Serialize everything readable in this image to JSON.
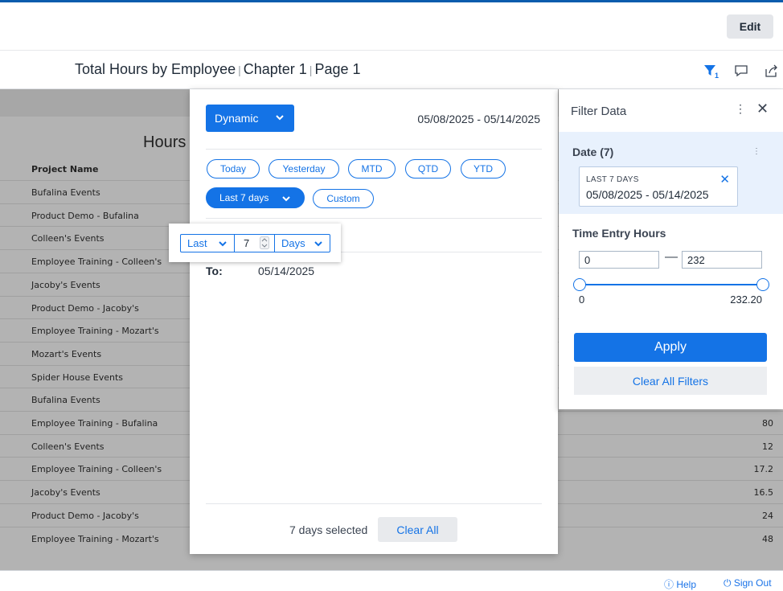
{
  "toolbar": {
    "edit_label": "Edit"
  },
  "report": {
    "title": "Total Hours by Employee",
    "chapter": "Chapter 1",
    "page": "Page 1",
    "filter_count": "1"
  },
  "underlay": {
    "heading": "Hours",
    "column_header": "Project Name",
    "rows": [
      {
        "name": "Bufalina Events",
        "value": ""
      },
      {
        "name": "Product Demo - Bufalina",
        "value": ""
      },
      {
        "name": "Colleen's Events",
        "value": ""
      },
      {
        "name": "Employee Training - Colleen's",
        "value": ""
      },
      {
        "name": "Jacoby's Events",
        "value": ""
      },
      {
        "name": "Product Demo - Jacoby's",
        "value": ""
      },
      {
        "name": "Employee Training - Mozart's",
        "value": ""
      },
      {
        "name": "Mozart's Events",
        "value": ""
      },
      {
        "name": "Spider House Events",
        "value": ""
      },
      {
        "name": "Bufalina Events",
        "value": ""
      },
      {
        "name": "Employee Training - Bufalina",
        "value": "80"
      },
      {
        "name": "Colleen's Events",
        "value": "12"
      },
      {
        "name": "Employee Training - Colleen's",
        "value": "17.2"
      },
      {
        "name": "Jacoby's Events",
        "value": "16.5"
      },
      {
        "name": "Product Demo - Jacoby's",
        "value": "24"
      },
      {
        "name": "Employee Training - Mozart's",
        "value": "48"
      }
    ]
  },
  "date_panel": {
    "mode_label": "Dynamic",
    "range": "05/08/2025 - 05/14/2025",
    "presets": [
      "Today",
      "Yesterday",
      "MTD",
      "QTD",
      "YTD"
    ],
    "active_preset": "Last 7 days",
    "custom_label": "Custom",
    "last_label": "Last",
    "last_count": "7",
    "unit_label": "Days",
    "to_label": "To:",
    "to_value": "05/14/2025",
    "selected_text": "7 days selected",
    "clear_all_label": "Clear All"
  },
  "filter_panel": {
    "title": "Filter Data",
    "date_label": "Date (7)",
    "chip_caption": "LAST 7 DAYS",
    "chip_value": "05/08/2025 - 05/14/2025",
    "hours_label": "Time Entry Hours",
    "min_input": "0",
    "max_input": "232",
    "slider_min": "0",
    "slider_max": "232.20",
    "apply_label": "Apply",
    "clear_label": "Clear All Filters"
  },
  "footer": {
    "help": "Help",
    "sign_out": "Sign Out"
  },
  "colors": {
    "accent": "#1473e6",
    "overlay": "#b3b3b3"
  }
}
